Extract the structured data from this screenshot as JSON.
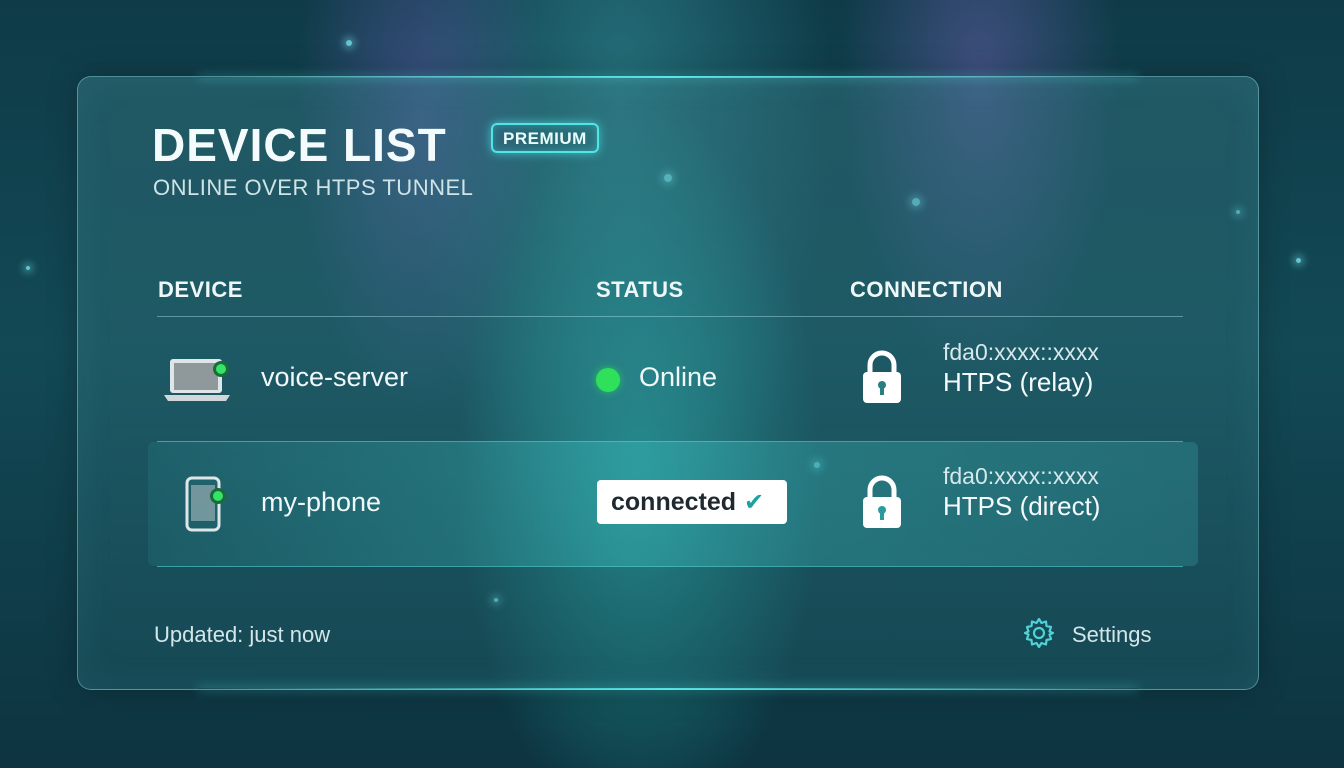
{
  "header": {
    "title": "DEVICE LIST",
    "badge": "PREMIUM",
    "subtitle": "ONLINE OVER HTPS TUNNEL"
  },
  "table": {
    "columns": [
      "DEVICE",
      "STATUS",
      "CONNECTION"
    ],
    "rows": [
      {
        "device_icon": "laptop-icon",
        "device": "voice-server",
        "status": "Online",
        "status_color": "#2ee05a",
        "address": "fda0:xxxx::xxxx",
        "protocol": "HTPS (relay)",
        "connection_icon": "lock-icon"
      },
      {
        "device_icon": "phone-icon",
        "device": "my-phone",
        "status": "connected",
        "status_icon": "check-icon",
        "address": "fda0:xxxx::xxxx",
        "protocol": "HTPS (direct)",
        "connection_icon": "lock-icon"
      }
    ]
  },
  "footer": {
    "updated": "Updated: just now",
    "settings_label": "Settings",
    "settings_icon": "gear-icon"
  },
  "colors": {
    "accent": "#4fe6e8",
    "online": "#2ee05a",
    "background": "#124955"
  }
}
